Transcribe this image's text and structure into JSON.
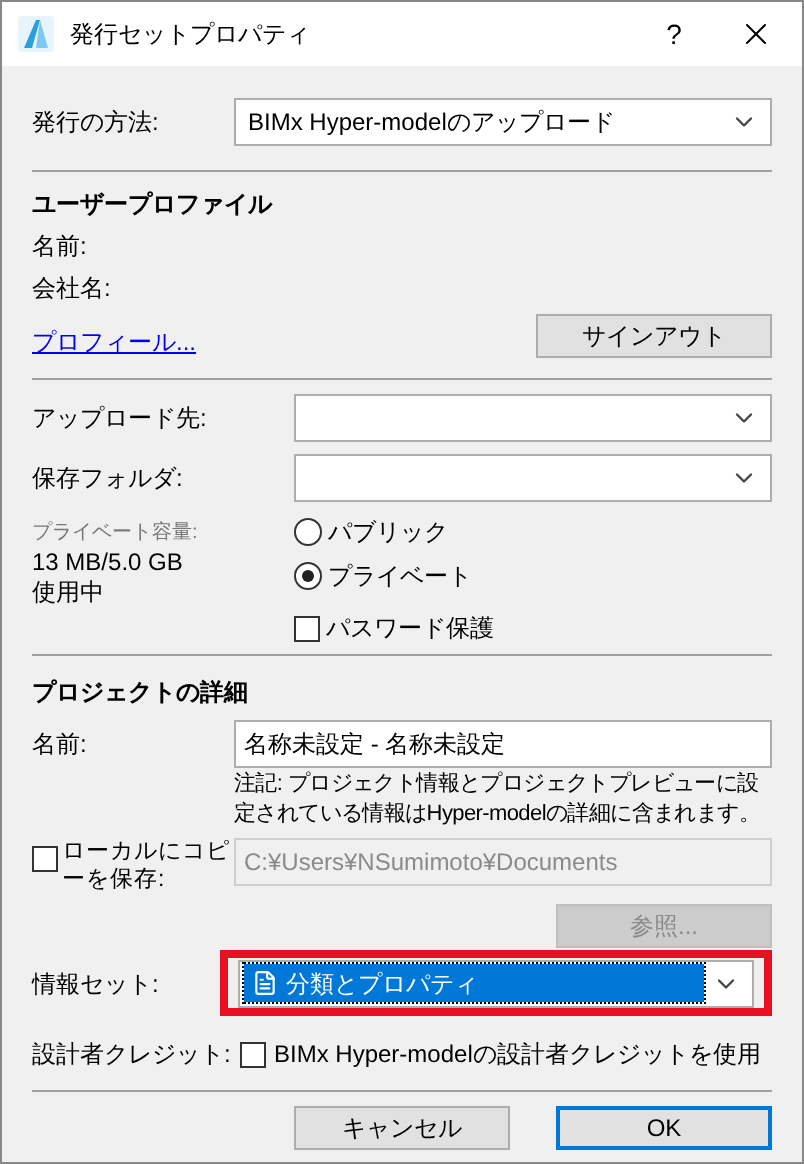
{
  "window": {
    "title": "発行セットプロパティ",
    "help": "?"
  },
  "method": {
    "label": "発行の方法:",
    "value": "BIMx Hyper-modelのアップロード"
  },
  "user_profile": {
    "heading": "ユーザープロファイル",
    "name_label": "名前:",
    "company_label": "会社名:",
    "profile_link": "プロフィール...",
    "sign_out": "サインアウト"
  },
  "upload": {
    "destination_label": "アップロード先:",
    "folder_label": "保存フォルダ:",
    "storage_label": "プライベート容量:",
    "storage_usage": [
      "13 MB/5.0 GB",
      "使用中"
    ],
    "visibility": [
      {
        "label": "パブリック",
        "selected": false
      },
      {
        "label": "プライベート",
        "selected": true
      }
    ],
    "password": {
      "label": "パスワード保護",
      "checked": false
    }
  },
  "project": {
    "heading": "プロジェクトの詳細",
    "name_label": "名前:",
    "name_value": "名称未設定 - 名称未設定",
    "note": "注記: プロジェクト情報とプロジェクトプレビューに設定されている情報はHyper-modelの詳細に含まれます。",
    "local_copy": {
      "label": "ローカルにコピーを保存:",
      "checked": false,
      "path": "C:¥Users¥NSumimoto¥Documents",
      "browse": "参照...",
      "disabled": true
    },
    "info_set": {
      "label": "情報セット:",
      "value": "分類とプロパティ",
      "highlighted": true
    },
    "credit": {
      "label": "設計者クレジット:",
      "checkbox_label": "BIMx Hyper-modelの設計者クレジットを使用",
      "checked": false
    }
  },
  "buttons": [
    {
      "label": "キャンセル",
      "default": false
    },
    {
      "label": "OK",
      "default": true
    }
  ]
}
